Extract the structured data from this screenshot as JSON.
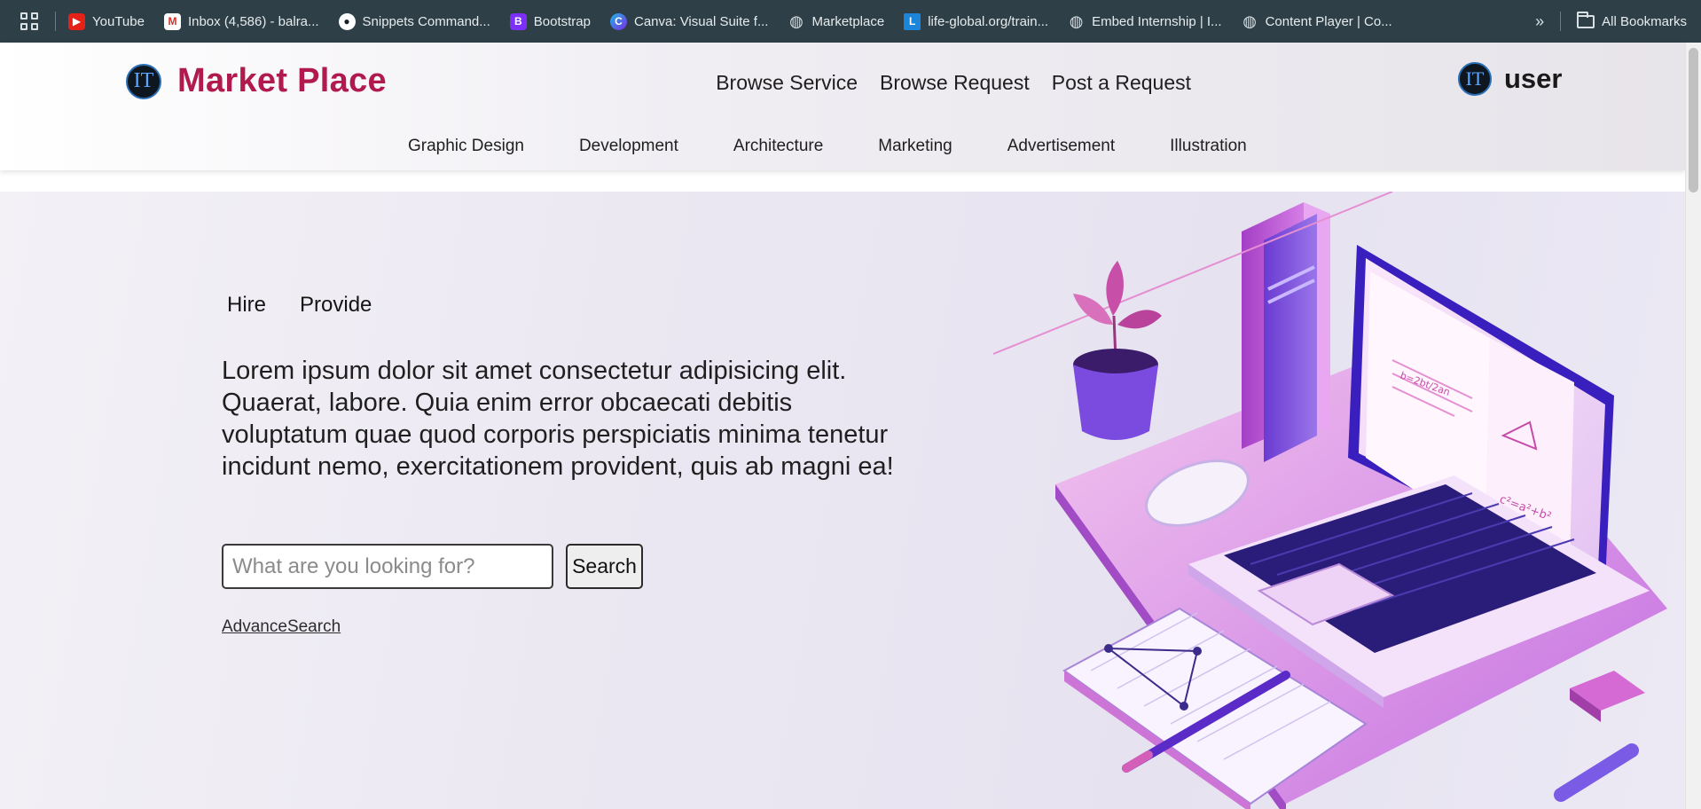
{
  "bookmarks": {
    "items": [
      {
        "label": "YouTube",
        "icon": "youtube-icon",
        "color": "#e62117",
        "glyph": "▶"
      },
      {
        "label": "Inbox (4,586) - balra...",
        "icon": "gmail-icon",
        "color": "#d93025",
        "glyph": "M"
      },
      {
        "label": "Snippets Command...",
        "icon": "github-icon",
        "color": "#ffffff",
        "glyph": "●"
      },
      {
        "label": "Bootstrap",
        "icon": "bootstrap-icon",
        "color": "#7b2ff7",
        "glyph": "B"
      },
      {
        "label": "Canva: Visual Suite f...",
        "icon": "canva-icon",
        "color": "#1fb5e4",
        "glyph": "C"
      },
      {
        "label": "Marketplace",
        "icon": "globe-icon",
        "color": "#d8e0e3",
        "glyph": "◍"
      },
      {
        "label": "life-global.org/train...",
        "icon": "life-global-icon",
        "color": "#1b86d9",
        "glyph": "L"
      },
      {
        "label": "Embed Internship | I...",
        "icon": "globe-icon",
        "color": "#d8e0e3",
        "glyph": "◍"
      },
      {
        "label": "Content Player | Co...",
        "icon": "globe-icon",
        "color": "#d8e0e3",
        "glyph": "◍"
      }
    ],
    "more_glyph": "»",
    "all_bookmarks": "All Bookmarks"
  },
  "header": {
    "logo_mark": "IT",
    "title": "Market Place",
    "nav": [
      "Browse Service",
      "Browse Request",
      "Post a Request"
    ],
    "user_mark": "IT",
    "user_label": "user",
    "categories": [
      "Graphic Design",
      "Development",
      "Architecture",
      "Marketing",
      "Advertisement",
      "Illustration"
    ]
  },
  "hero": {
    "tabs": [
      "Hire",
      "Provide"
    ],
    "text": "Lorem ipsum dolor sit amet consectetur adipisicing elit. Quaerat, labore. Quia enim error obcaecati debitis voluptatum quae quod corporis perspiciatis minima tenetur incidunt nemo, exercitationem provident, quis ab magni ea!",
    "search_placeholder": "What are you looking for?",
    "search_button": "Search",
    "advance_search": "AdvanceSearch",
    "illustration": {
      "book_note": "b=2bt/2an",
      "formula": "c²=a²+b²"
    }
  },
  "colors": {
    "brand": "#b01a4d",
    "bookmarks_bg": "#2e3f47",
    "accent_purple": "#8a3bd6"
  }
}
